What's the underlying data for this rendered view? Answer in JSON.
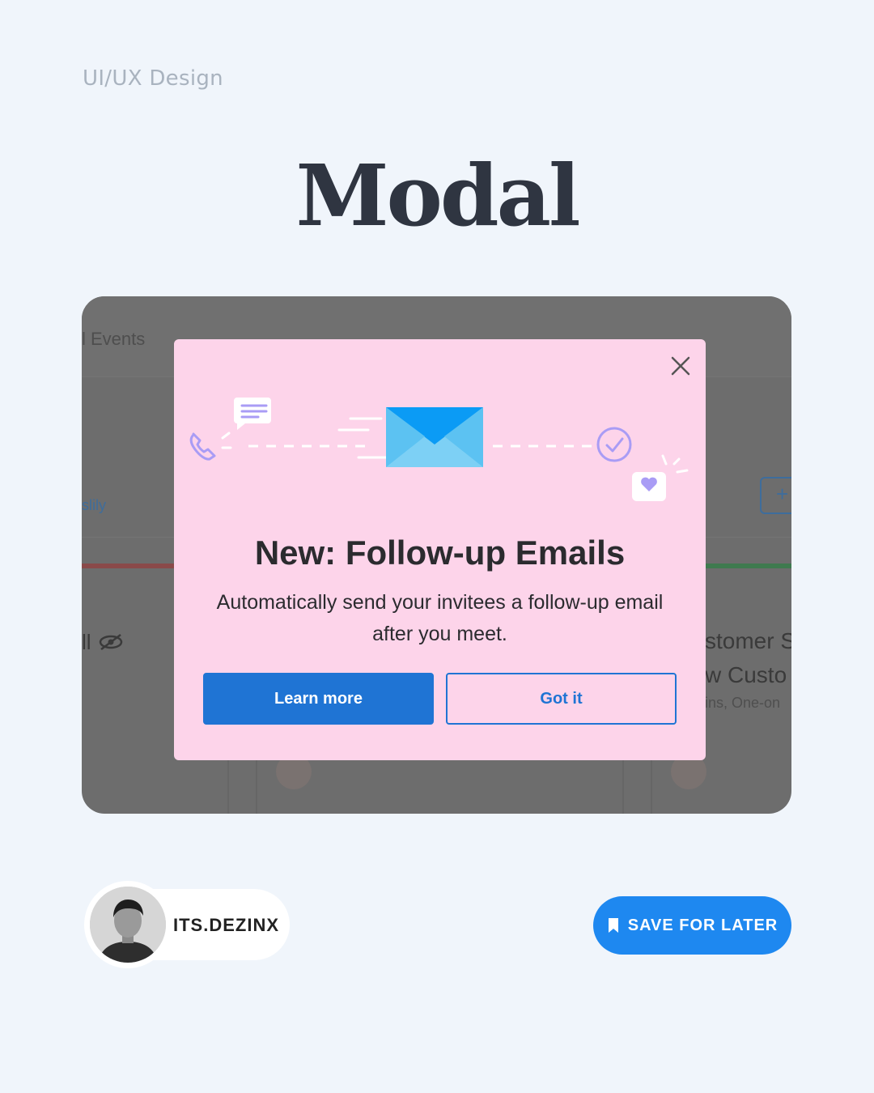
{
  "header": {
    "eyebrow": "UI/UX Design",
    "title": "Modal"
  },
  "background_app": {
    "events_label": "l Events",
    "partial_link": "slily",
    "partial_text_left": "ll",
    "partial_text_right_1": "stomer S",
    "partial_text_right_2": "w Custo",
    "partial_text_right_3": "ins, One-on",
    "plus_label": "+"
  },
  "modal": {
    "title": "New: Follow-up Emails",
    "body": "Automatically send your invitees a follow-up email after you meet.",
    "primary_button": "Learn more",
    "secondary_button": "Got it",
    "colors": {
      "background": "#fdd4ea",
      "primary": "#1f74d4"
    }
  },
  "author": {
    "name": "ITS.DEZINX"
  },
  "save_button": {
    "label": "SAVE FOR LATER",
    "color": "#1e88f0"
  }
}
